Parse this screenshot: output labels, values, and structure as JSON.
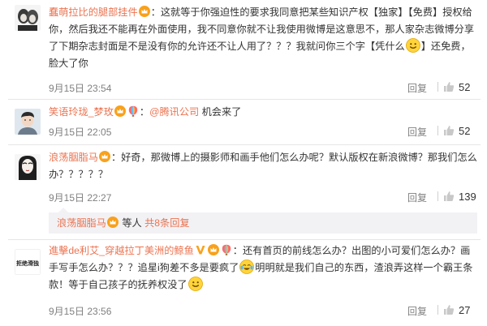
{
  "comments": [
    {
      "username": "蠢萌拉比的腿部挂件",
      "text_before_emoji": "：这就等于你强迫性的要求我同意把某些知识产权【独家】【免费】授权给你，然后我还不能再在外面使用，我不同意你就不让我使用微博是这意思不，那人家杂志微博分享了下期杂志封面是不是没有你的允许还不让人用了？？？我就问你三个字【凭什么",
      "text_after_emoji": "】还免费，脸大了你",
      "time": "9月15日 23:54",
      "reply_label": "回复",
      "likes": "52"
    },
    {
      "username": "笑语玲珑_梦玫",
      "text_before_link": "：",
      "link": "@腾讯公司",
      "text_after_link": " 机会来了",
      "time": "9月15日 22:05",
      "reply_label": "回复",
      "likes": "52"
    },
    {
      "username": "浪荡胭脂马",
      "text": "：好奇，那微博上的摄影师和画手他们怎么办呢？默认版权在新浪微博？那我们怎么办？？？？？",
      "time": "9月15日 22:27",
      "reply_label": "回复",
      "likes": "139"
    },
    {
      "username": "進擊de利艾_穿越拉丁美洲的鲸鱼",
      "text_before_emoji1": "：还有首页的前线怎么办？出图的小可爱们怎么办？画手写手怎么办？？？追星i狗差不多是要疯了",
      "text_between_emoji": "明明就是我们自己的东西，渣浪弄这样一个霸王条款！等于自己孩子的抚养权没了",
      "time": "9月15日 23:56",
      "reply_label": "回复",
      "likes": "27",
      "avatar_text": "拒绝滑独"
    }
  ],
  "subreply": {
    "username": "浪荡胭脂马",
    "text": " 等人 ",
    "count_link": "共8条回复"
  },
  "colors": {
    "username": "#eb7350",
    "meta": "#808080",
    "divider": "#e6e6e6",
    "subreply_bg": "#f2f2f5"
  },
  "icons": [
    "vip-crown-icon",
    "balloon-icon",
    "vip-v-icon",
    "smiley-emoji",
    "crying-laughing-emoji",
    "thumbs-up-icon"
  ]
}
